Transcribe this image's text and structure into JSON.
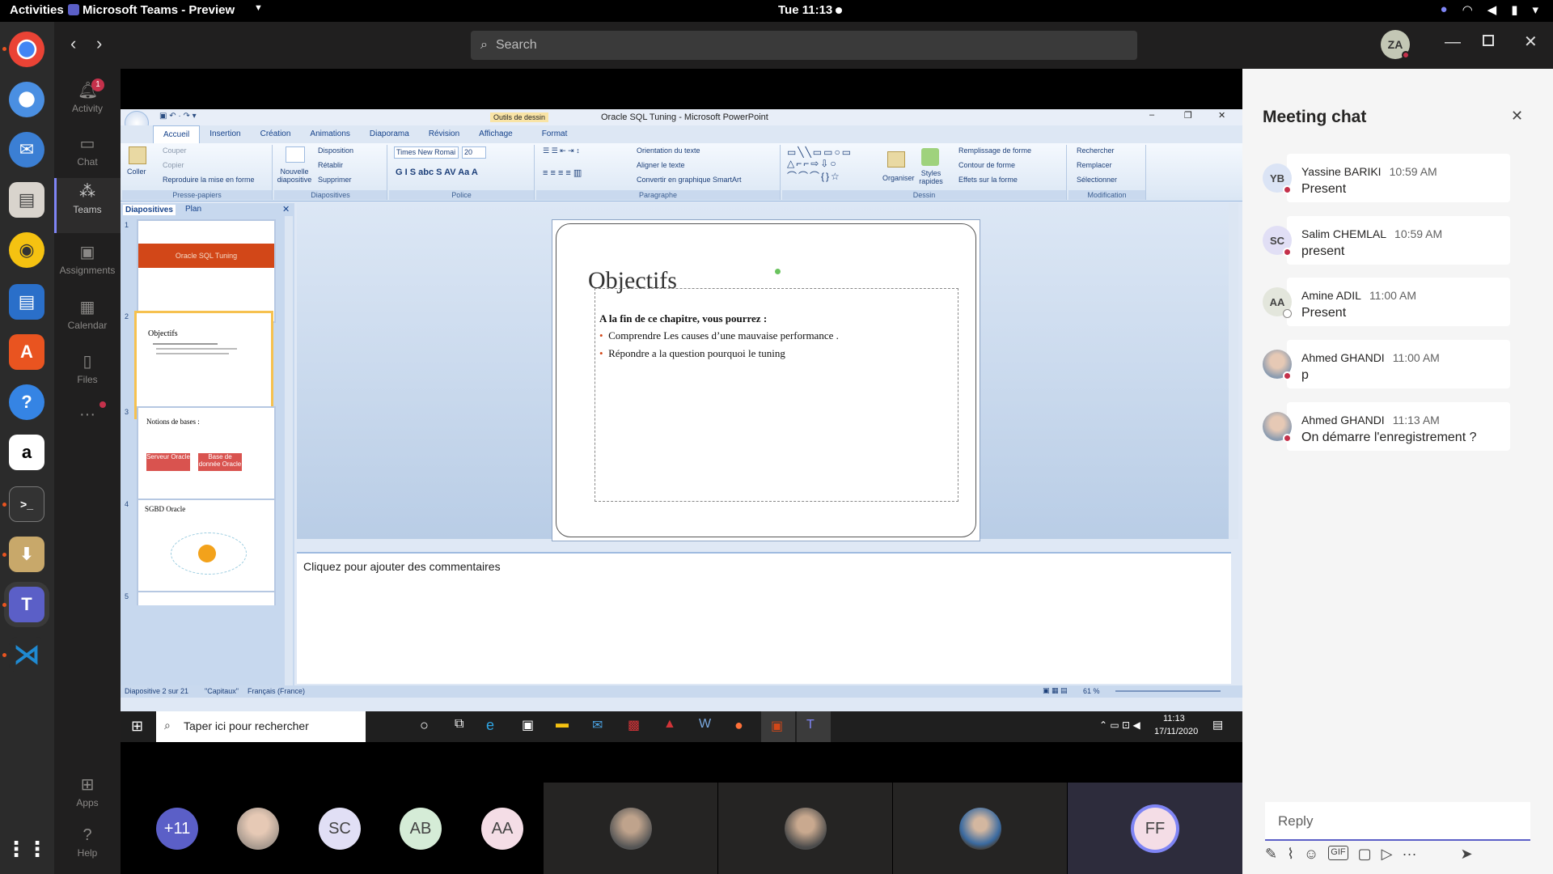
{
  "gnome": {
    "activities": "Activities",
    "app_name": "Microsoft Teams - Preview",
    "clock": "Tue 11:13"
  },
  "teams": {
    "search_placeholder": "Search",
    "user_initials": "ZA",
    "rail": [
      {
        "label": "Activity",
        "badge": "1"
      },
      {
        "label": "Chat"
      },
      {
        "label": "Teams"
      },
      {
        "label": "Assignments"
      },
      {
        "label": "Calendar"
      },
      {
        "label": "Files"
      },
      {
        "label": "Apps"
      },
      {
        "label": "Help"
      }
    ]
  },
  "powerpoint": {
    "title": "Oracle SQL Tuning - Microsoft PowerPoint",
    "context_tab": "Outils de dessin",
    "tabs": [
      "Accueil",
      "Insertion",
      "Création",
      "Animations",
      "Diaporama",
      "Révision",
      "Affichage",
      "Format"
    ],
    "ribbon": {
      "clipboard": {
        "paste": "Coller",
        "cut": "Couper",
        "copy": "Copier",
        "format_painter": "Reproduire la mise en forme",
        "label": "Presse-papiers"
      },
      "slides": {
        "new_slide": "Nouvelle diapositive",
        "layout": "Disposition",
        "reset": "Rétablir",
        "delete": "Supprimer",
        "label": "Diapositives"
      },
      "font": {
        "family": "Times New Romai",
        "size": "20",
        "label": "Police"
      },
      "paragraph": {
        "text_direction": "Orientation du texte",
        "align_text": "Aligner le texte",
        "smartart": "Convertir en graphique SmartArt",
        "label": "Paragraphe"
      },
      "drawing": {
        "arrange": "Organiser",
        "quick_styles": "Styles rapides",
        "fill": "Remplissage de forme",
        "outline": "Contour de forme",
        "effects": "Effets sur la forme",
        "label": "Dessin"
      },
      "editing": {
        "find": "Rechercher",
        "replace": "Remplacer",
        "select": "Sélectionner",
        "label": "Modification"
      }
    },
    "panel_tabs": [
      "Diapositives",
      "Plan"
    ],
    "thumbnails": [
      {
        "num": "1",
        "title": "Oracle SQL Tuning"
      },
      {
        "num": "2",
        "title": "Objectifs"
      },
      {
        "num": "3",
        "title": "Notions de bases :",
        "box1": "Serveur Oracle",
        "box2": "Base de donnée Oracle"
      },
      {
        "num": "4",
        "title": "SGBD Oracle"
      },
      {
        "num": "5"
      }
    ],
    "slide": {
      "title": "Objectifs",
      "intro": "A la fin de ce chapitre, vous pourrez :",
      "bullets": [
        "Comprendre  Les causes d’une mauvaise performance  .",
        "Répondre a la question pourquoi le tuning"
      ]
    },
    "notes_placeholder": "Cliquez pour ajouter des commentaires",
    "status": {
      "slide": "Diapositive 2 sur 21",
      "theme": "\"Capitaux\"",
      "language": "Français (France)",
      "zoom": "61 %"
    }
  },
  "windows_taskbar": {
    "search_placeholder": "Taper ici pour rechercher",
    "time": "11:13",
    "date": "17/11/2020"
  },
  "participants": {
    "overflow": "+11",
    "initials": [
      "SC",
      "AB",
      "AA",
      "FF"
    ]
  },
  "chat": {
    "title": "Meeting chat",
    "messages": [
      {
        "initials": "YB",
        "name": "Yassine BARIKI",
        "time": "10:59 AM",
        "text": "Present",
        "presence": "busy"
      },
      {
        "initials": "SC",
        "name": "Salim CHEMLAL",
        "time": "10:59 AM",
        "text": "present",
        "presence": "busy"
      },
      {
        "initials": "AA",
        "name": "Amine ADIL",
        "time": "11:00 AM",
        "text": "Present",
        "presence": "away"
      },
      {
        "initials": "",
        "name": "Ahmed GHANDI",
        "time": "11:00 AM",
        "text": "p",
        "presence": "busy"
      },
      {
        "initials": "",
        "name": "Ahmed GHANDI",
        "time": "11:13 AM",
        "text": "On démarre l'enregistrement ?",
        "presence": "busy"
      }
    ],
    "reply_placeholder": "Reply"
  }
}
